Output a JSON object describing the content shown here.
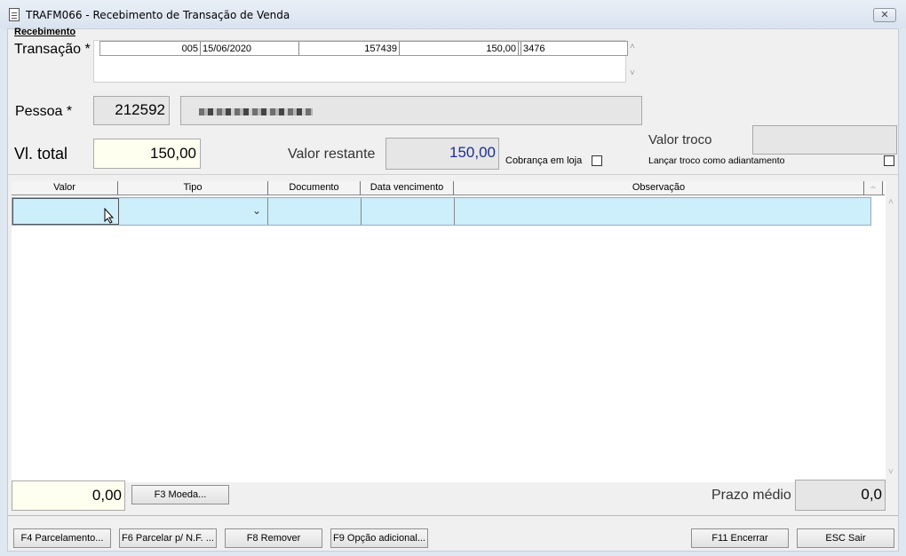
{
  "window": {
    "title": "TRAFM066 - Recebimento de Transação de Venda",
    "close_symbol": "✕"
  },
  "section": {
    "title": "Recebimento"
  },
  "transacao": {
    "label": "Transação *",
    "row": [
      "005",
      "15/06/2020",
      "157439",
      "150,00",
      "3476"
    ]
  },
  "pessoa": {
    "label": "Pessoa *",
    "code": "212592"
  },
  "vl_total": {
    "label": "Vl. total",
    "value": "150,00"
  },
  "valor_restante": {
    "label": "Valor restante",
    "value": "150,00"
  },
  "cobranca": {
    "label": "Cobrança em loja"
  },
  "valor_troco": {
    "label": "Valor troco",
    "value": ""
  },
  "lancar_troco": {
    "label": "Lançar troco como adiantamento"
  },
  "grid": {
    "columns": [
      "Valor",
      "Tipo",
      "Documento",
      "Data vencimento",
      "Observação"
    ]
  },
  "footer": {
    "total_value": "0,00",
    "moeda_button": "F3 Moeda...",
    "prazo_label": "Prazo médio",
    "prazo_value": "0,0"
  },
  "buttons": {
    "parcelamento": "F4 Parcelamento...",
    "parcelar_nf": "F6 Parcelar p/ N.F. ...",
    "remover": "F8 Remover",
    "opcao": "F9 Opção adicional...",
    "encerrar": "F11 Encerrar",
    "sair": "ESC Sair"
  },
  "colors": {
    "highlight_row": "#cdeefb",
    "input_yellow": "#fffff0",
    "value_blue": "#1a2f8f"
  }
}
